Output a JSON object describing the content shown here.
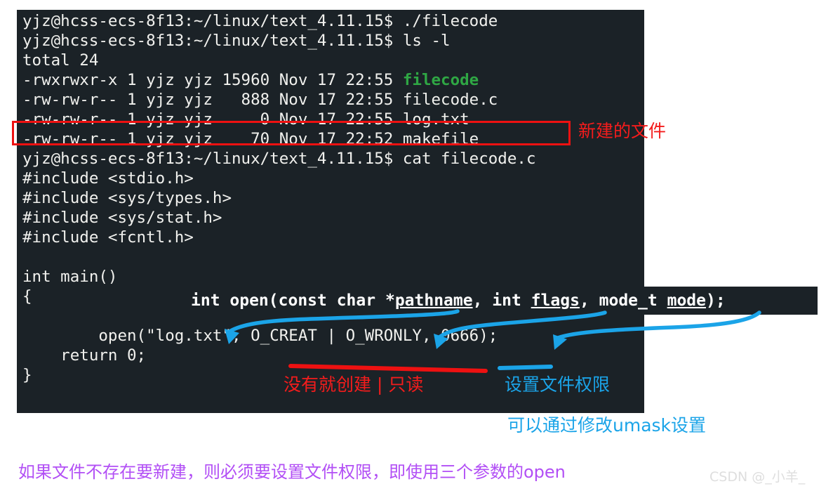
{
  "terminal": {
    "prompt": "yjz@hcss-ecs-8f13:~/linux/text_4.11.15$",
    "lines": [
      {
        "text": "yjz@hcss-ecs-8f13:~/linux/text_4.11.15$ ./filecode"
      },
      {
        "text": "yjz@hcss-ecs-8f13:~/linux/text_4.11.15$ ls -l"
      },
      {
        "text": "total 24"
      },
      {
        "text": "-rwxrwxr-x 1 yjz yjz 15960 Nov 17 22:55 ",
        "green": "filecode"
      },
      {
        "text": "-rw-rw-r-- 1 yjz yjz   888 Nov 17 22:55 filecode.c"
      },
      {
        "text": "-rw-rw-r-- 1 yjz yjz     0 Nov 17 22:55 log.txt"
      },
      {
        "text": "-rw-rw-r-- 1 yjz yjz    70 Nov 17 22:52 makefile"
      },
      {
        "text": "yjz@hcss-ecs-8f13:~/linux/text_4.11.15$ cat filecode.c"
      },
      {
        "text": "#include <stdio.h>"
      },
      {
        "text": "#include <sys/types.h>"
      },
      {
        "text": "#include <sys/stat.h>"
      },
      {
        "text": "#include <fcntl.h>"
      },
      {
        "text": ""
      },
      {
        "text": "int main()"
      },
      {
        "text": "{"
      },
      {
        "text": "        open(\"log.txt\", O_CREAT | O_WRONLY, 0666);"
      },
      {
        "text": "    return 0;"
      },
      {
        "text": "}"
      }
    ],
    "listing": {
      "total_label": "total 24",
      "rows": [
        {
          "perms": "-rwxrwxr-x",
          "links": "1",
          "owner": "yjz",
          "group": "yjz",
          "size": "15960",
          "month": "Nov",
          "day": "17",
          "time": "22:55",
          "name": "filecode"
        },
        {
          "perms": "-rw-rw-r--",
          "links": "1",
          "owner": "yjz",
          "group": "yjz",
          "size": "888",
          "month": "Nov",
          "day": "17",
          "time": "22:55",
          "name": "filecode.c"
        },
        {
          "perms": "-rw-rw-r--",
          "links": "1",
          "owner": "yjz",
          "group": "yjz",
          "size": "0",
          "month": "Nov",
          "day": "17",
          "time": "22:55",
          "name": "log.txt"
        },
        {
          "perms": "-rw-rw-r--",
          "links": "1",
          "owner": "yjz",
          "group": "yjz",
          "size": "70",
          "month": "Nov",
          "day": "17",
          "time": "22:52",
          "name": "makefile"
        }
      ]
    },
    "commands": [
      "./filecode",
      "ls -l",
      "cat filecode.c"
    ],
    "bg_color": "#1b2227",
    "fg_color": "#f1f1ee",
    "dir_color": "#2fa744"
  },
  "prototype_overlay": {
    "prefix": "int open(const char ",
    "star": "*",
    "param1": "pathname",
    "sep1": ", int ",
    "param2": "flags",
    "sep2": ", ",
    "type3": "mode_t",
    "space": " ",
    "param3": "mode",
    "suffix": ");",
    "full_text": "int open(const char *pathname, int flags, mode_t mode);"
  },
  "annotations": {
    "new_file_label": "新建的文件",
    "creat_label": "没有就创建 | 只读",
    "mode_label": "设置文件权限",
    "umask_label": "可以通过修改umask设置",
    "summary_label": "如果文件不存在要新建，则必须要设置文件权限，即使用三个参数的open",
    "colors": {
      "red": "#f41c1c",
      "blue": "#1ba4e8",
      "purple": "#b24ff5"
    }
  },
  "watermark": {
    "text": "CSDN @_小羊_"
  }
}
